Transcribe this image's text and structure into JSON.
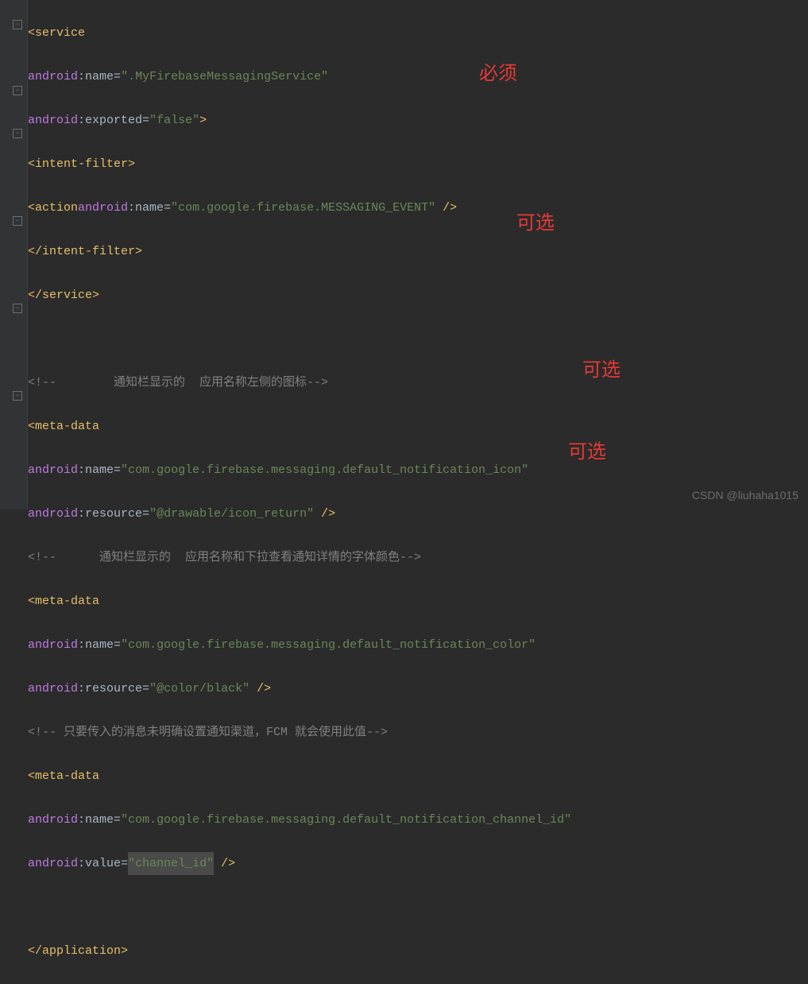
{
  "code": {
    "service_open": "<service",
    "attr_android": "android",
    "attr_name": "name",
    "attr_exported": "exported",
    "attr_resource": "resource",
    "attr_value": "value",
    "service_name_val": "\".MyFirebaseMessagingService\"",
    "exported_val": "\"false\"",
    "intent_filter_open": "<intent-filter>",
    "action_open": "<action",
    "action_name_val": "\"com.google.firebase.MESSAGING_EVENT\"",
    "self_close": " />",
    "intent_filter_close": "</intent-filter>",
    "service_close": "</service>",
    "comment1": "<!--        通知栏显示的  应用名称左侧的图标-->",
    "meta_data_open": "<meta-data",
    "meta1_name_val": "\"com.google.firebase.messaging.default_notification_icon\"",
    "meta1_res_val": "\"@drawable/icon_return\"",
    "comment2": "<!--      通知栏显示的  应用名称和下拉查看通知详情的字体颜色-->",
    "meta2_name_val": "\"com.google.firebase.messaging.default_notification_color\"",
    "meta2_res_val": "\"@color/black\"",
    "comment3": "<!-- 只要传入的消息未明确设置通知渠道，FCM 就会使用此值-->",
    "meta3_name_val": "\"com.google.firebase.messaging.default_notification_channel_id\"",
    "meta3_val_val": "\"channel_id\"",
    "app_close": "</application>",
    "gt": ">",
    "eq": "=",
    "colon": ":"
  },
  "annotations": {
    "a1": "必须",
    "a2": "可选",
    "a3": "可选",
    "a4": "可选"
  },
  "watermark": "CSDN @liuhaha1015"
}
